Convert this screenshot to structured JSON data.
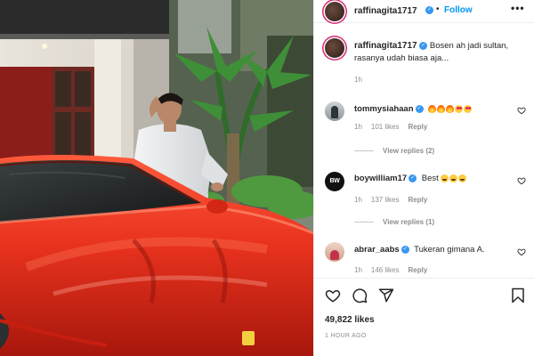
{
  "post": {
    "author": "raffinagita1717",
    "follow_label": "Follow",
    "more_label": "•••",
    "separator": "•",
    "verified_mark": "✓"
  },
  "caption": {
    "username": "raffinagita1717",
    "text": "Bosen ah jadi sultan, rasanya udah biasa aja...",
    "time": "1h"
  },
  "comments": [
    {
      "username": "tommysiahaan",
      "text": "",
      "emojis": [
        "fire",
        "fire",
        "fire",
        "heart-eyes",
        "heart-eyes"
      ],
      "time": "1h",
      "likes": "101 likes",
      "reply": "Reply",
      "view_replies": "View replies (2)"
    },
    {
      "username": "boywilliam17",
      "text": "Best",
      "emojis": [
        "laugh",
        "laugh",
        "laugh"
      ],
      "avatar_text": "BW",
      "time": "1h",
      "likes": "137 likes",
      "reply": "Reply",
      "view_replies": "View replies (1)"
    },
    {
      "username": "abrar_aabs",
      "text": "Tukeran gimana A.",
      "emojis": [],
      "time": "1h",
      "likes": "146 likes",
      "reply": "Reply"
    }
  ],
  "actions": {
    "icons": [
      "heart-icon",
      "comment-icon",
      "share-icon",
      "bookmark-icon"
    ],
    "likes": "49,822 likes",
    "time_ago": "1 HOUR AGO"
  },
  "colors": {
    "link": "#0095f6",
    "verified": "#3897f0",
    "secondary_text": "#8e8e8e",
    "car": "#e8321e"
  }
}
